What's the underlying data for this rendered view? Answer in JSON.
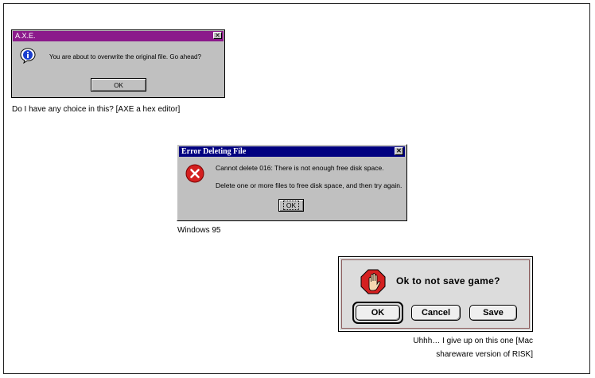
{
  "axe_dialog": {
    "title": "A.X.E.",
    "close_label": "✕",
    "message": "You are about to overwrite the original file.  Go ahead?",
    "ok_label": "OK",
    "caption": "Do I have any choice in this? [AXE a hex editor]"
  },
  "win95_dialog": {
    "title": "Error Deleting File",
    "close_label": "✕",
    "message_line1": "Cannot delete 016: There is not enough free disk space.",
    "message_line2": "Delete one or more files to free disk space, and then try again.",
    "ok_label": "OK",
    "caption": "Windows 95"
  },
  "mac_dialog": {
    "message": "Ok to not save game?",
    "ok_label": "OK",
    "cancel_label": "Cancel",
    "save_label": "Save",
    "caption_line1": "Uhhh… I give up on this one [Mac",
    "caption_line2": "shareware version of RISK]"
  },
  "icons": {
    "axe_icon": "info-icon",
    "win95_icon": "error-icon",
    "mac_icon": "stop-hand-icon"
  },
  "colors": {
    "axe_titlebar": "#8b1a8b",
    "win95_titlebar": "#000080",
    "dialog_face": "#c0c0c0",
    "error_red": "#d42020"
  }
}
